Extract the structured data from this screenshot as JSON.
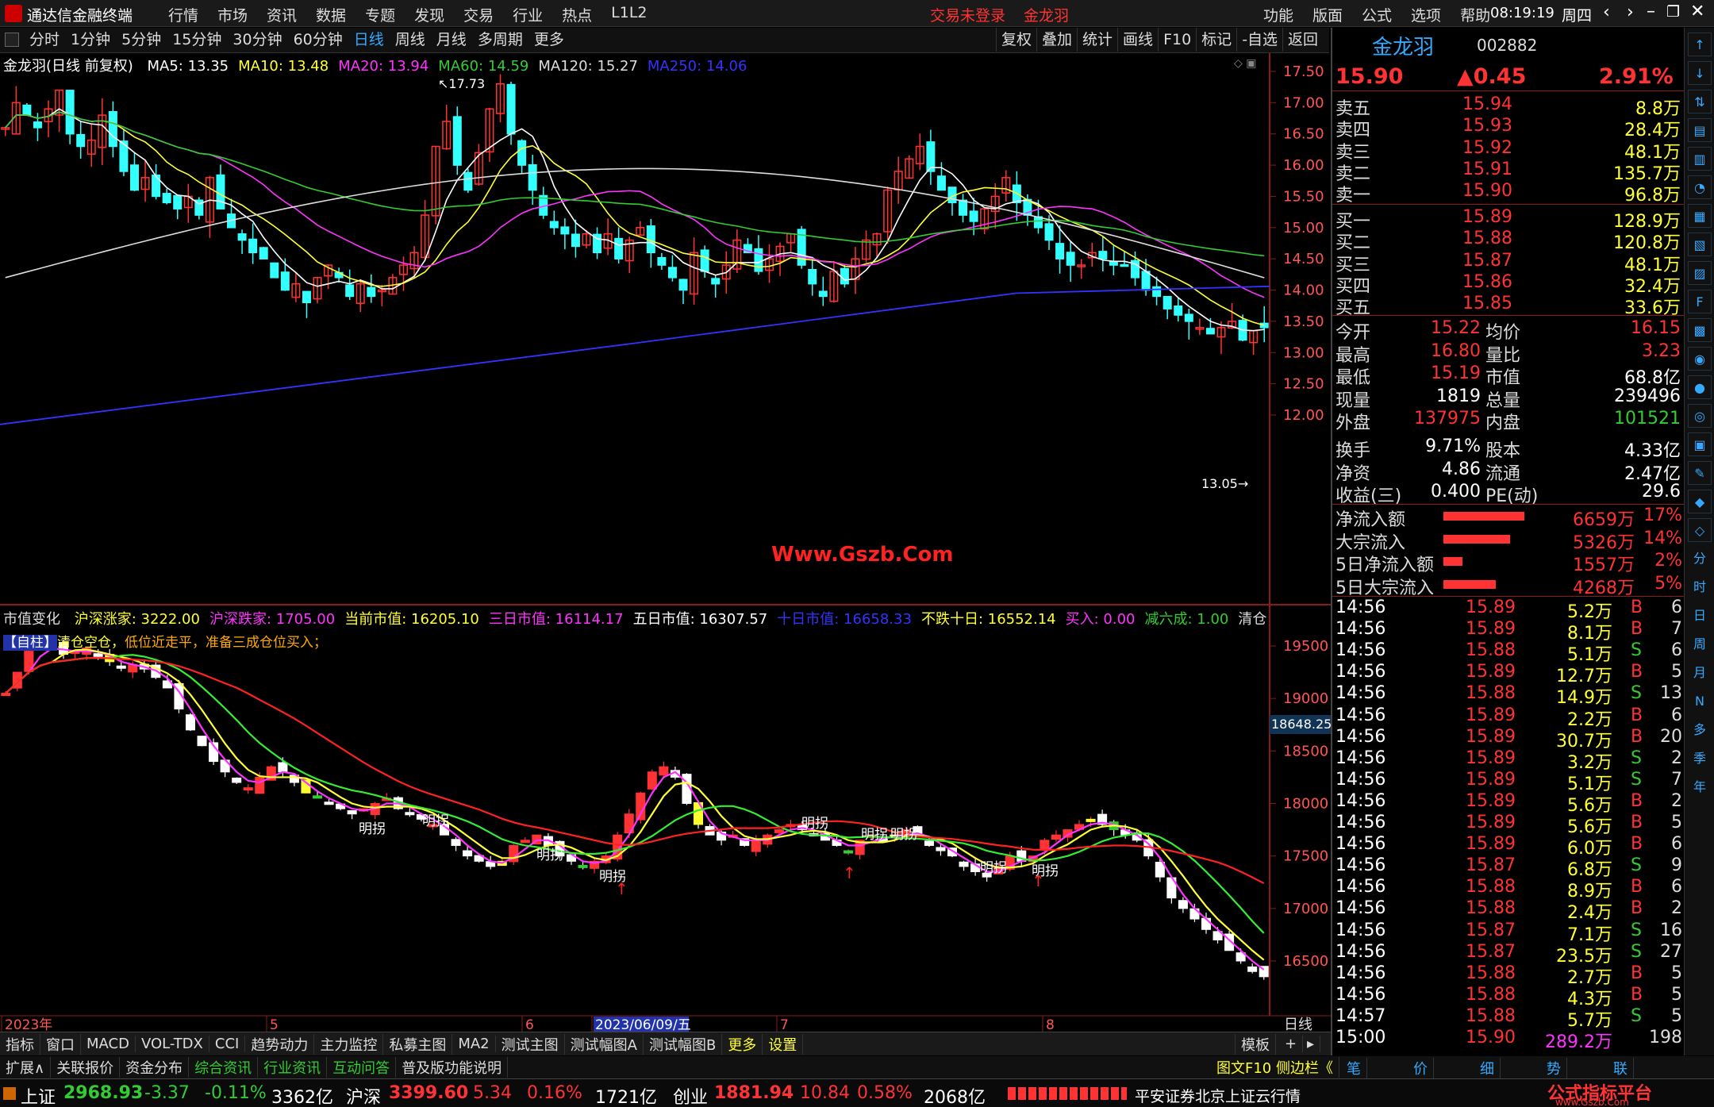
{
  "app": {
    "title": "通达信金融终端",
    "menus": [
      "行情",
      "市场",
      "资讯",
      "数据",
      "专题",
      "发现",
      "交易",
      "行业",
      "热点",
      "L1L2"
    ],
    "login": "交易未登录",
    "stock_name": "金龙羽",
    "right_menus": [
      "功能",
      "版面",
      "公式",
      "选项",
      "帮助"
    ],
    "time": "08:19:19",
    "weekday": "周四"
  },
  "toolbar": {
    "periods": [
      "分时",
      "1分钟",
      "5分钟",
      "15分钟",
      "30分钟",
      "60分钟",
      "日线",
      "周线",
      "月线",
      "多周期",
      "更多"
    ],
    "active": "日线",
    "right": [
      "复权",
      "叠加",
      "统计",
      "画线",
      "F10",
      "标记",
      "-自选",
      "返回"
    ]
  },
  "main_chart": {
    "title": "金龙羽(日线 前复权)",
    "ma": [
      {
        "label": "MA5: 13.35",
        "color": "#fff"
      },
      {
        "label": "MA10: 13.48",
        "color": "#ff3"
      },
      {
        "label": "MA20: 13.94",
        "color": "#f3f"
      },
      {
        "label": "MA60: 14.59",
        "color": "#3c3"
      },
      {
        "label": "MA120: 15.27",
        "color": "#ddd"
      },
      {
        "label": "MA250: 14.06",
        "color": "#33f"
      }
    ],
    "high_label": "17.73",
    "low_label": "13.05",
    "watermark": "Www.Gszb.Com",
    "y_ticks": [
      "17.50",
      "17.00",
      "16.50",
      "16.00",
      "15.50",
      "15.00",
      "14.50",
      "14.00",
      "13.50",
      "13.00",
      "12.50",
      "12.00"
    ]
  },
  "sub_chart": {
    "title": "市值变化",
    "items": [
      {
        "label": "沪深涨家: 3222.00",
        "color": "#ff3"
      },
      {
        "label": "沪深跌家: 1705.00",
        "color": "#f3f"
      },
      {
        "label": "当前市值: 16205.10",
        "color": "#ff3"
      },
      {
        "label": "三日市值: 16114.17",
        "color": "#f3f"
      },
      {
        "label": "五日市值: 16307.57",
        "color": "#fff"
      },
      {
        "label": "十日市值: 16658.33",
        "color": "#33f"
      },
      {
        "label": "不跌十日: 16552.14",
        "color": "#ff3"
      },
      {
        "label": "买入: 0.00",
        "color": "#f3f"
      },
      {
        "label": "减六成: 1.00",
        "color": "#3c3"
      },
      {
        "label": "清仓",
        "color": "#ddd"
      }
    ],
    "tag": "【自柱】",
    "hint": "清仓空仓，",
    "hint2": "低位近走平，准备三成仓位买入；",
    "y_ticks": [
      "19500",
      "19000",
      "18500",
      "18000",
      "17500",
      "17000",
      "16500"
    ],
    "cursor_value": "18648.25",
    "pattern_label": "明拐"
  },
  "x_axis": {
    "labels": [
      "2023年",
      "5",
      "6",
      "2023/06/09/五",
      "7",
      "8"
    ],
    "right": "日线"
  },
  "quote": {
    "name": "金龙羽",
    "code": "002882",
    "price": "15.90",
    "change": "▲0.45",
    "pct": "2.91%"
  },
  "sells": [
    {
      "l": "卖五",
      "p": "15.94",
      "v": "8.8万"
    },
    {
      "l": "卖四",
      "p": "15.93",
      "v": "28.4万"
    },
    {
      "l": "卖三",
      "p": "15.92",
      "v": "48.1万"
    },
    {
      "l": "卖二",
      "p": "15.91",
      "v": "135.7万"
    },
    {
      "l": "卖一",
      "p": "15.90",
      "v": "96.8万"
    }
  ],
  "buys": [
    {
      "l": "买一",
      "p": "15.89",
      "v": "128.9万"
    },
    {
      "l": "买二",
      "p": "15.88",
      "v": "120.8万"
    },
    {
      "l": "买三",
      "p": "15.87",
      "v": "48.1万"
    },
    {
      "l": "买四",
      "p": "15.86",
      "v": "32.4万"
    },
    {
      "l": "买五",
      "p": "15.85",
      "v": "33.6万"
    }
  ],
  "stats": [
    {
      "a": "今开",
      "av": "15.22",
      "b": "均价",
      "bv": "16.15"
    },
    {
      "a": "最高",
      "av": "16.80",
      "b": "量比",
      "bv": "3.23"
    },
    {
      "a": "最低",
      "av": "15.19",
      "b": "市值",
      "bv": "68.8亿"
    },
    {
      "a": "现量",
      "av": "1819",
      "b": "总量",
      "bv": "239496"
    },
    {
      "a": "外盘",
      "av": "137975",
      "b": "内盘",
      "bv": "101521"
    },
    {
      "a": "换手",
      "av": "9.71%",
      "b": "股本",
      "bv": "4.33亿"
    },
    {
      "a": "净资",
      "av": "4.86",
      "b": "流通",
      "bv": "2.47亿"
    },
    {
      "a": "收益(三)",
      "av": "0.400",
      "b": "PE(动)",
      "bv": "29.6"
    }
  ],
  "flows": [
    {
      "l": "净流入额",
      "v": "6659万",
      "p": "17%",
      "r": 0.85
    },
    {
      "l": "大宗流入",
      "v": "5326万",
      "p": "14%",
      "r": 0.7
    },
    {
      "l": "5日净流入额",
      "v": "1557万",
      "p": "2%",
      "r": 0.2
    },
    {
      "l": "5日大宗流入",
      "v": "4268万",
      "p": "5%",
      "r": 0.55
    }
  ],
  "ticks": [
    {
      "t": "14:56",
      "p": "15.89",
      "v": "5.2万",
      "s": "B",
      "n": "6"
    },
    {
      "t": "14:56",
      "p": "15.89",
      "v": "8.1万",
      "s": "B",
      "n": "7"
    },
    {
      "t": "14:56",
      "p": "15.88",
      "v": "5.1万",
      "s": "S",
      "n": "6"
    },
    {
      "t": "14:56",
      "p": "15.89",
      "v": "12.7万",
      "s": "B",
      "n": "5"
    },
    {
      "t": "14:56",
      "p": "15.88",
      "v": "14.9万",
      "s": "S",
      "n": "13"
    },
    {
      "t": "14:56",
      "p": "15.89",
      "v": "2.2万",
      "s": "B",
      "n": "6"
    },
    {
      "t": "14:56",
      "p": "15.89",
      "v": "30.7万",
      "s": "B",
      "n": "20"
    },
    {
      "t": "14:56",
      "p": "15.89",
      "v": "3.2万",
      "s": "S",
      "n": "2"
    },
    {
      "t": "14:56",
      "p": "15.89",
      "v": "5.1万",
      "s": "S",
      "n": "7"
    },
    {
      "t": "14:56",
      "p": "15.89",
      "v": "5.6万",
      "s": "B",
      "n": "2"
    },
    {
      "t": "14:56",
      "p": "15.89",
      "v": "5.6万",
      "s": "B",
      "n": "5"
    },
    {
      "t": "14:56",
      "p": "15.89",
      "v": "6.0万",
      "s": "B",
      "n": "6"
    },
    {
      "t": "14:56",
      "p": "15.87",
      "v": "6.8万",
      "s": "S",
      "n": "9"
    },
    {
      "t": "14:56",
      "p": "15.88",
      "v": "8.9万",
      "s": "B",
      "n": "6"
    },
    {
      "t": "14:56",
      "p": "15.88",
      "v": "2.4万",
      "s": "B",
      "n": "2"
    },
    {
      "t": "14:56",
      "p": "15.87",
      "v": "7.1万",
      "s": "S",
      "n": "16"
    },
    {
      "t": "14:56",
      "p": "15.87",
      "v": "23.5万",
      "s": "S",
      "n": "27"
    },
    {
      "t": "14:56",
      "p": "15.88",
      "v": "2.7万",
      "s": "B",
      "n": "5"
    },
    {
      "t": "14:56",
      "p": "15.88",
      "v": "4.3万",
      "s": "B",
      "n": "5"
    },
    {
      "t": "14:57",
      "p": "15.88",
      "v": "5.7万",
      "s": "S",
      "n": "5"
    },
    {
      "t": "15:00",
      "p": "15.90",
      "v": "289.2万",
      "s": "",
      "n": "198"
    }
  ],
  "bottom_tabs": [
    "指标",
    "窗口",
    "MACD",
    "VOL-TDX",
    "CCI",
    "趋势动力",
    "主力监控",
    "私募主图",
    "MA2",
    "测试主图",
    "测试幅图A",
    "测试幅图B",
    "更多",
    "设置"
  ],
  "bottom_right": "模板",
  "bottom2": {
    "items": [
      "扩展∧",
      "关联报价",
      "资金分布",
      "综合资讯",
      "行业资讯",
      "互动问答",
      "普及版功能说明"
    ],
    "right": "图文F10 侧边栏《",
    "rtabs": [
      "笔",
      "价",
      "细",
      "势",
      "联"
    ]
  },
  "status": {
    "sh_name": "上证",
    "sh": "2968.93",
    "sh_ch": "-3.37",
    "sh_pct": "-0.11%",
    "sh_amt": "3362亿",
    "hs_name": "沪深",
    "hs": "3399.60",
    "hs_ch": "5.34",
    "hs_pct": "0.16%",
    "hs_amt": "1721亿",
    "cy_name": "创业",
    "cy": "1881.94",
    "cy_ch": "10.84",
    "cy_pct": "0.58%",
    "cy_amt": "2068亿",
    "server": "平安证券北京上证云行情",
    "logo": "公式指标平台",
    "logo2": "www.Gszb.Com"
  },
  "side_icons": [
    "分",
    "时",
    "日",
    "周",
    "月",
    "N",
    "多",
    "季",
    "年"
  ],
  "colors": {
    "up": "#ff3333",
    "down": "#33ffff",
    "ma5": "#ffffff",
    "ma10": "#ffff33",
    "ma20": "#ff33ff",
    "ma60": "#33cc33",
    "ma120": "#dddddd",
    "ma250": "#3333ff"
  }
}
